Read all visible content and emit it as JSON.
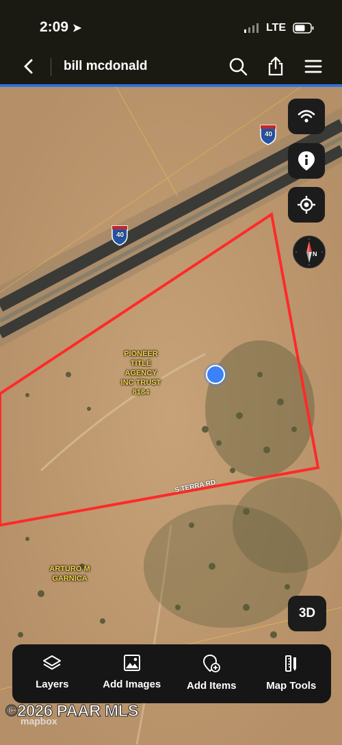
{
  "status": {
    "time": "2:09",
    "network": "LTE"
  },
  "header": {
    "title": "bill mcdonald"
  },
  "map": {
    "parcel_labels": [
      {
        "text": "PIONEER\nTITLE\nAGENCY\nINC TRUST\n8184"
      },
      {
        "text": "ARTURO M\nGARNICA"
      }
    ],
    "shield_label": "40",
    "road_label": "S TERRA RD",
    "btn_3d": "3D"
  },
  "toolbar": {
    "items": [
      {
        "label": "Layers",
        "icon": "layers-icon"
      },
      {
        "label": "Add Images",
        "icon": "image-icon"
      },
      {
        "label": "Add Items",
        "icon": "add-pin-icon"
      },
      {
        "label": "Map Tools",
        "icon": "ruler-icon"
      }
    ]
  },
  "watermark": "©2026 PAAR MLS",
  "attribution": "mapbox",
  "colors": {
    "parcel_outline": "#ff2a2a",
    "accent_blue": "#2d73d8",
    "label_yellow": "#f2d44a"
  }
}
